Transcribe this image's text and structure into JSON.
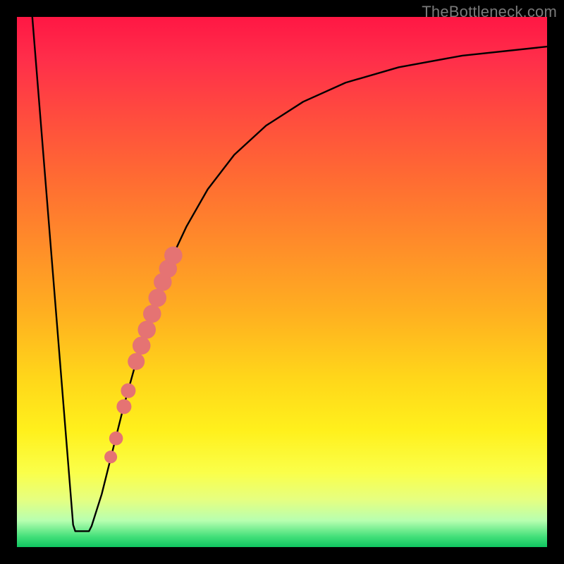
{
  "watermark": "TheBottleneck.com",
  "chart_data": {
    "type": "line",
    "title": "",
    "xlabel": "",
    "ylabel": "",
    "xlim": [
      0,
      100
    ],
    "ylim": [
      0,
      100
    ],
    "background_gradient": {
      "top": "#ff1744",
      "upper_mid": "#ff8a2a",
      "mid": "#ffd61a",
      "lower_mid": "#faff4a",
      "bottom": "#0fc560"
    },
    "series": [
      {
        "name": "left-falling-line",
        "stroke": "#000000",
        "points": [
          {
            "x": 2.9,
            "y": 100.0
          },
          {
            "x": 10.6,
            "y": 4.2
          }
        ]
      },
      {
        "name": "bottom-flat",
        "stroke": "#000000",
        "points": [
          {
            "x": 10.6,
            "y": 4.2
          },
          {
            "x": 11.0,
            "y": 3.0
          },
          {
            "x": 12.4,
            "y": 3.0
          },
          {
            "x": 13.6,
            "y": 3.0
          },
          {
            "x": 14.1,
            "y": 4.0
          }
        ]
      },
      {
        "name": "rising-curve",
        "stroke": "#000000",
        "points": [
          {
            "x": 14.1,
            "y": 4.0
          },
          {
            "x": 16.0,
            "y": 10.0
          },
          {
            "x": 18.0,
            "y": 18.0
          },
          {
            "x": 20.0,
            "y": 26.0
          },
          {
            "x": 22.5,
            "y": 35.0
          },
          {
            "x": 25.0,
            "y": 43.5
          },
          {
            "x": 28.0,
            "y": 52.0
          },
          {
            "x": 32.0,
            "y": 60.5
          },
          {
            "x": 36.0,
            "y": 67.5
          },
          {
            "x": 41.0,
            "y": 74.0
          },
          {
            "x": 47.0,
            "y": 79.5
          },
          {
            "x": 54.0,
            "y": 84.0
          },
          {
            "x": 62.0,
            "y": 87.6
          },
          {
            "x": 72.0,
            "y": 90.5
          },
          {
            "x": 84.0,
            "y": 92.7
          },
          {
            "x": 100.0,
            "y": 94.4
          }
        ]
      }
    ],
    "markers": {
      "name": "highlight-dots",
      "fill": "#e57373",
      "points": [
        {
          "x": 17.7,
          "y": 17.0,
          "r": 1.2
        },
        {
          "x": 18.7,
          "y": 20.5,
          "r": 1.3
        },
        {
          "x": 20.2,
          "y": 26.5,
          "r": 1.4
        },
        {
          "x": 21.0,
          "y": 29.5,
          "r": 1.4
        },
        {
          "x": 22.5,
          "y": 35.0,
          "r": 1.6
        },
        {
          "x": 23.5,
          "y": 38.0,
          "r": 1.7
        },
        {
          "x": 24.5,
          "y": 41.0,
          "r": 1.7
        },
        {
          "x": 25.5,
          "y": 44.0,
          "r": 1.7
        },
        {
          "x": 26.5,
          "y": 47.0,
          "r": 1.7
        },
        {
          "x": 27.5,
          "y": 50.0,
          "r": 1.7
        },
        {
          "x": 28.5,
          "y": 52.5,
          "r": 1.7
        },
        {
          "x": 29.5,
          "y": 55.0,
          "r": 1.7
        }
      ]
    }
  }
}
